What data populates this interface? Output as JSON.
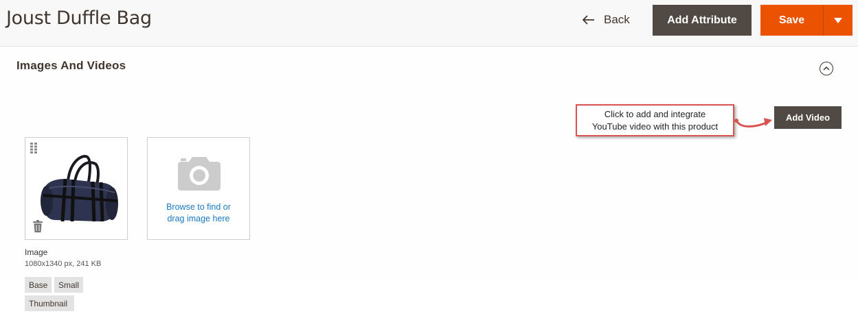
{
  "header": {
    "title": "Joust Duffle Bag",
    "back_label": "Back",
    "add_attribute_label": "Add Attribute",
    "save_label": "Save"
  },
  "section": {
    "title": "Images And Videos"
  },
  "callout": {
    "line1": "Click to add and integrate",
    "line2": "YouTube video with this product"
  },
  "add_video_label": "Add Video",
  "upload": {
    "line1": "Browse to find or",
    "line2": "drag image here"
  },
  "image": {
    "label": "Image",
    "meta": "1080x1340 px, 241 KB",
    "roles": [
      "Base",
      "Small",
      "Thumbnail"
    ]
  },
  "colors": {
    "primary": "#eb5202",
    "secondary": "#514943",
    "link": "#1979c3",
    "callout_border": "#d9534f"
  }
}
